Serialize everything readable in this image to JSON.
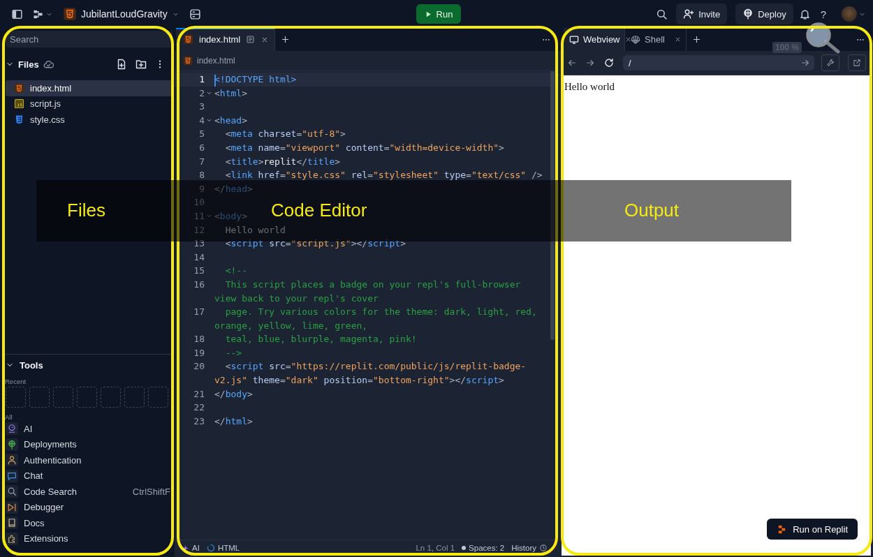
{
  "top_bar": {
    "project_name": "JubilantLoudGravity",
    "run_button": "Run",
    "invite_button": "Invite",
    "deploy_button": "Deploy",
    "help_button": "?"
  },
  "files_panel": {
    "search": {
      "placeholder": "Search"
    },
    "title": "Files",
    "files": [
      {
        "name": "index.html",
        "kind": "html",
        "selected": true
      },
      {
        "name": "script.js",
        "kind": "js",
        "selected": false
      },
      {
        "name": "style.css",
        "kind": "css",
        "selected": false
      }
    ]
  },
  "tools_panel": {
    "title": "Tools",
    "recent_label": "Recent",
    "all_label": "All",
    "items": [
      {
        "name": "AI",
        "kind": "ai"
      },
      {
        "name": "Deployments",
        "kind": "deployments"
      },
      {
        "name": "Authentication",
        "kind": "authentication"
      },
      {
        "name": "Chat",
        "kind": "chat"
      },
      {
        "name": "Code Search",
        "kind": "search",
        "shortcut": "CtrlShiftF"
      },
      {
        "name": "Debugger",
        "kind": "debugger"
      },
      {
        "name": "Docs",
        "kind": "docs"
      },
      {
        "name": "Extensions",
        "kind": "extensions"
      }
    ]
  },
  "editor": {
    "tabs": [
      {
        "label": "index.html",
        "kind": "html",
        "selected": true
      }
    ],
    "breadcrumb": "index.html",
    "lines": [
      {
        "n": "1",
        "fold": false,
        "active": true,
        "tokens": [
          {
            "kind": "doctype",
            "text": "<!DOCTYPE html>"
          }
        ]
      },
      {
        "n": "2",
        "fold": true,
        "active": false,
        "tokens": [
          {
            "kind": "punct",
            "text": "<"
          },
          {
            "kind": "tag",
            "text": "html"
          },
          {
            "kind": "punct",
            "text": ">"
          }
        ]
      },
      {
        "n": "3",
        "fold": false,
        "active": false
      },
      {
        "n": "4",
        "fold": true,
        "active": false,
        "tokens": [
          {
            "kind": "punct",
            "text": "<"
          },
          {
            "kind": "tag",
            "text": "head"
          },
          {
            "kind": "punct",
            "text": ">"
          }
        ]
      },
      {
        "n": "5",
        "fold": false,
        "active": false,
        "tokens": [
          {
            "kind": "punct",
            "text": "  <"
          },
          {
            "kind": "tag",
            "text": "meta"
          },
          {
            "kind": "attr",
            "text": " charset"
          },
          {
            "kind": "punct",
            "text": "="
          },
          {
            "kind": "string",
            "text": "\"utf-8\""
          },
          {
            "kind": "punct",
            "text": ">"
          }
        ]
      },
      {
        "n": "6",
        "fold": false,
        "active": false,
        "tokens": [
          {
            "kind": "punct",
            "text": "  <"
          },
          {
            "kind": "tag",
            "text": "meta"
          },
          {
            "kind": "attr",
            "text": " name"
          },
          {
            "kind": "punct",
            "text": "="
          },
          {
            "kind": "string",
            "text": "\"viewport\""
          },
          {
            "kind": "attr",
            "text": " content"
          },
          {
            "kind": "punct",
            "text": "="
          },
          {
            "kind": "string",
            "text": "\"width=device-width\""
          },
          {
            "kind": "punct",
            "text": ">"
          }
        ]
      },
      {
        "n": "7",
        "fold": false,
        "active": false,
        "tokens": [
          {
            "kind": "punct",
            "text": "  <"
          },
          {
            "kind": "tag",
            "text": "title"
          },
          {
            "kind": "punct",
            "text": ">"
          },
          {
            "kind": "text",
            "text": "replit"
          },
          {
            "kind": "punct",
            "text": "</"
          },
          {
            "kind": "tag",
            "text": "title"
          },
          {
            "kind": "punct",
            "text": ">"
          }
        ]
      },
      {
        "n": "8",
        "fold": false,
        "active": false,
        "tokens": [
          {
            "kind": "punct",
            "text": "  <"
          },
          {
            "kind": "tag",
            "text": "link"
          },
          {
            "kind": "attr",
            "text": " href"
          },
          {
            "kind": "punct",
            "text": "="
          },
          {
            "kind": "string",
            "text": "\"style.css\""
          },
          {
            "kind": "attr",
            "text": " rel"
          },
          {
            "kind": "punct",
            "text": "="
          },
          {
            "kind": "string",
            "text": "\"stylesheet\""
          },
          {
            "kind": "attr",
            "text": " type"
          },
          {
            "kind": "punct",
            "text": "="
          },
          {
            "kind": "string",
            "text": "\"text/css\""
          },
          {
            "kind": "punct",
            "text": " />"
          }
        ]
      },
      {
        "n": "9",
        "fold": false,
        "active": false,
        "tokens": [
          {
            "kind": "punct",
            "text": "</"
          },
          {
            "kind": "tag",
            "text": "head"
          },
          {
            "kind": "punct",
            "text": ">"
          }
        ]
      },
      {
        "n": "10",
        "fold": false,
        "active": false
      },
      {
        "n": "11",
        "fold": true,
        "active": false,
        "tokens": [
          {
            "kind": "punct",
            "text": "<"
          },
          {
            "kind": "tag",
            "text": "body"
          },
          {
            "kind": "punct",
            "text": ">"
          }
        ]
      },
      {
        "n": "12",
        "fold": false,
        "active": false,
        "tokens": [
          {
            "kind": "text",
            "text": "  Hello world"
          }
        ]
      },
      {
        "n": "13",
        "fold": false,
        "active": false,
        "tokens": [
          {
            "kind": "punct",
            "text": "  <"
          },
          {
            "kind": "tag",
            "text": "script"
          },
          {
            "kind": "attr",
            "text": " src"
          },
          {
            "kind": "punct",
            "text": "="
          },
          {
            "kind": "string",
            "text": "\"script.js\""
          },
          {
            "kind": "punct",
            "text": "></"
          },
          {
            "kind": "tag",
            "text": "script"
          },
          {
            "kind": "punct",
            "text": ">"
          }
        ]
      },
      {
        "n": "14",
        "fold": false,
        "active": false
      },
      {
        "n": "15",
        "fold": false,
        "active": false,
        "tokens": [
          {
            "kind": "comment",
            "text": "  <!--"
          }
        ]
      },
      {
        "n": "16",
        "fold": false,
        "active": false,
        "tokens": [
          {
            "kind": "comment",
            "text": "  This script places a badge on your repl's full-browser view back to your repl's cover"
          }
        ]
      },
      {
        "n": "17",
        "fold": false,
        "active": false,
        "tokens": [
          {
            "kind": "comment",
            "text": "  page. Try various colors for the theme: dark, light, red, orange, yellow, lime, green,"
          }
        ]
      },
      {
        "n": "18",
        "fold": false,
        "active": false,
        "tokens": [
          {
            "kind": "comment",
            "text": "  teal, blue, blurple, magenta, pink!"
          }
        ]
      },
      {
        "n": "19",
        "fold": false,
        "active": false,
        "tokens": [
          {
            "kind": "comment",
            "text": "  -->"
          }
        ]
      },
      {
        "n": "20",
        "fold": false,
        "active": false,
        "tokens": [
          {
            "kind": "punct",
            "text": "  <"
          },
          {
            "kind": "tag",
            "text": "script"
          },
          {
            "kind": "attr",
            "text": " src"
          },
          {
            "kind": "punct",
            "text": "="
          },
          {
            "kind": "string",
            "text": "\"https://replit.com/public/js/replit-badge-v2.js\""
          },
          {
            "kind": "attr",
            "text": " theme"
          },
          {
            "kind": "punct",
            "text": "="
          },
          {
            "kind": "string",
            "text": "\"dark\""
          },
          {
            "kind": "attr",
            "text": " position"
          },
          {
            "kind": "punct",
            "text": "="
          },
          {
            "kind": "string",
            "text": "\"bottom-right\""
          },
          {
            "kind": "punct",
            "text": "></"
          },
          {
            "kind": "tag",
            "text": "script"
          },
          {
            "kind": "punct",
            "text": ">"
          }
        ]
      },
      {
        "n": "21",
        "fold": false,
        "active": false,
        "tokens": [
          {
            "kind": "punct",
            "text": "</"
          },
          {
            "kind": "tag",
            "text": "body"
          },
          {
            "kind": "punct",
            "text": ">"
          }
        ]
      },
      {
        "n": "22",
        "fold": false,
        "active": false
      },
      {
        "n": "23",
        "fold": false,
        "active": false,
        "tokens": [
          {
            "kind": "punct",
            "text": "</"
          },
          {
            "kind": "tag",
            "text": "html"
          },
          {
            "kind": "punct",
            "text": ">"
          }
        ]
      }
    ],
    "status_bar": {
      "ai": "AI",
      "language": "HTML",
      "position": "Ln 1, Col 1",
      "spaces": "Spaces: 2",
      "history": "History"
    }
  },
  "output": {
    "tabs": [
      {
        "label": "Webview",
        "kind": "webview",
        "selected": true
      },
      {
        "label": "Shell",
        "kind": "shell",
        "selected": false
      }
    ],
    "url": "/",
    "zoom": "100 %",
    "page_text": "Hello world",
    "badge_button": "Run on Replit"
  },
  "annotations": [
    {
      "label": "Files"
    },
    {
      "label": "Code Editor"
    },
    {
      "label": "Output"
    }
  ]
}
